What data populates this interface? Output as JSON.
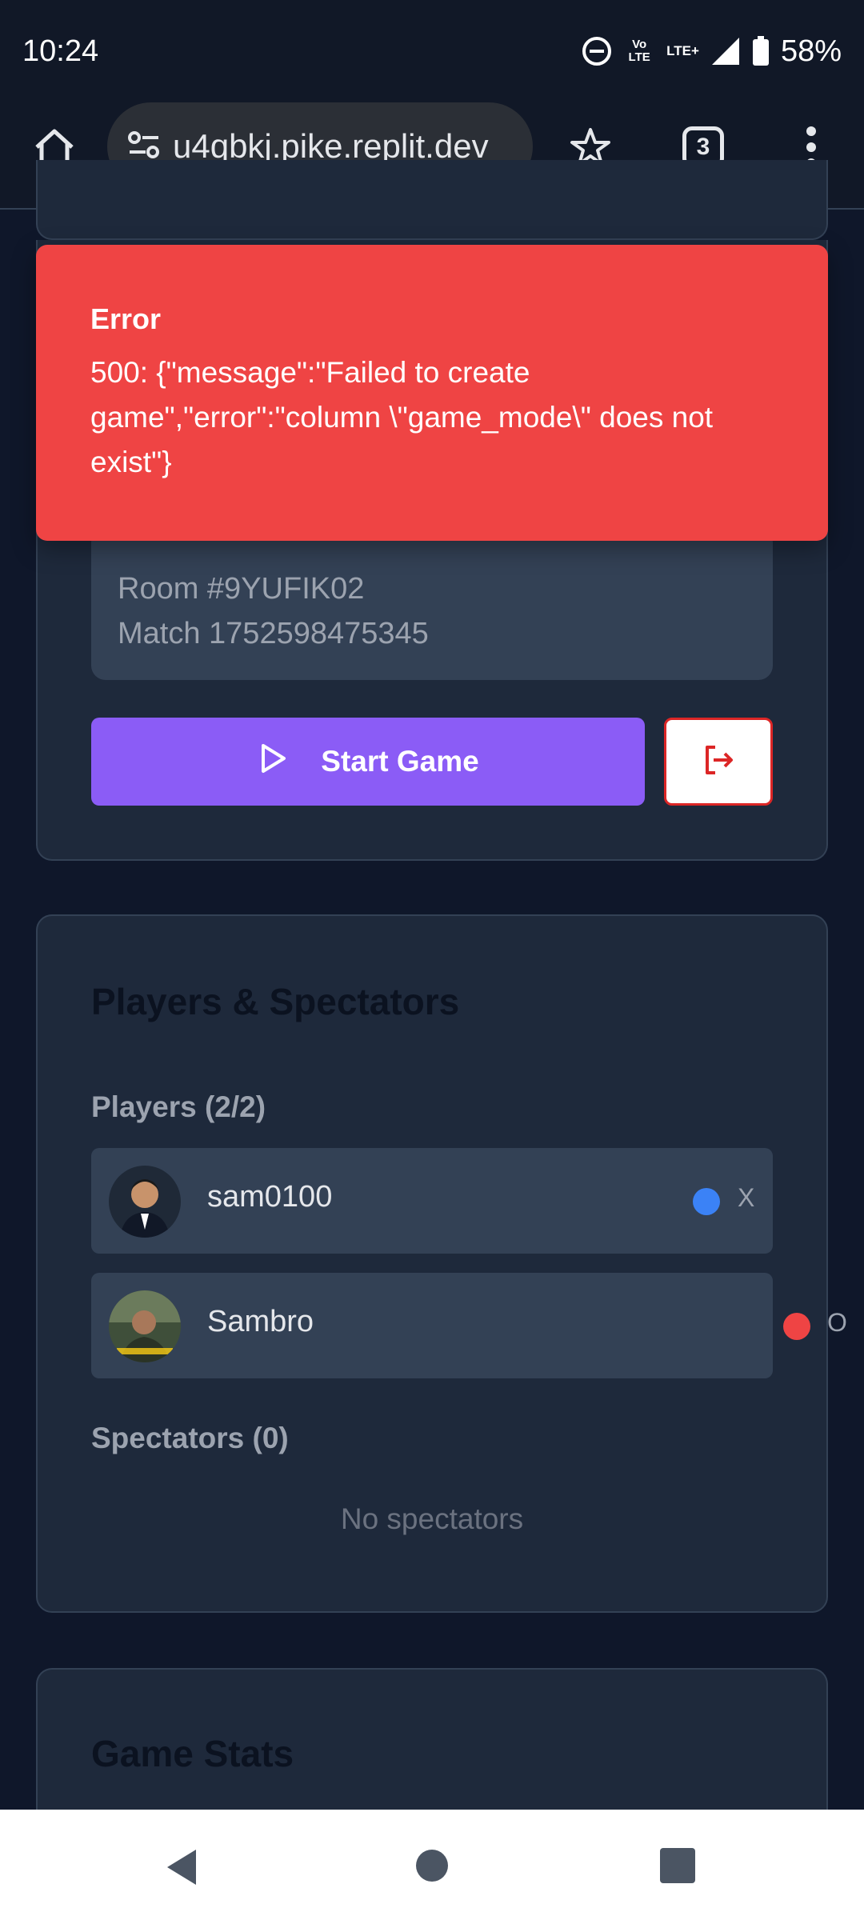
{
  "status_bar": {
    "time": "10:24",
    "battery": "58%",
    "volte": "Vo LTE",
    "lte": "LTE+"
  },
  "browser": {
    "url": "u4qbkj.pike.replit.dev",
    "tab_count": "3"
  },
  "room": {
    "room_line": "Room #9YUFIK02",
    "match_line": "Match 1752598475345"
  },
  "actions": {
    "start_label": "Start Game"
  },
  "players_section": {
    "title": "Players & Spectators",
    "players_heading": "Players (2/2)",
    "players": [
      {
        "name": "sam0100",
        "symbol": "X",
        "color": "#3b82f6"
      },
      {
        "name": "Sambro",
        "symbol": "O",
        "color": "#ef4444"
      }
    ],
    "spectators_heading": "Spectators (0)",
    "no_spectators": "No spectators"
  },
  "stats_section": {
    "title": "Game Stats"
  },
  "toast": {
    "title": "Error",
    "message": "500: {\"message\":\"Failed to create game\",\"error\":\"column \\\"game_mode\\\" does not exist\"}"
  },
  "colors": {
    "page_bg": "#0f172a",
    "card_bg": "#1e293b",
    "accent_purple": "#8b5cf6",
    "error_red": "#ef4444"
  }
}
